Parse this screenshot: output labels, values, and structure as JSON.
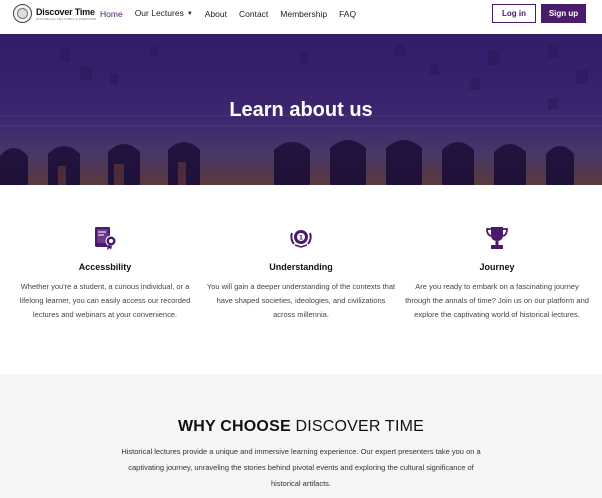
{
  "header": {
    "logo_title": "Discover Time",
    "logo_sub": "HISTORICAL LECTURES & WEBINARS",
    "nav": [
      {
        "label": "Home",
        "active": true
      },
      {
        "label": "Our Lectures",
        "dropdown": true
      },
      {
        "label": "About"
      },
      {
        "label": "Contact"
      },
      {
        "label": "Membership"
      },
      {
        "label": "FAQ"
      }
    ],
    "login_label": "Log in",
    "signup_label": "Sign up"
  },
  "hero": {
    "title": "Learn about us"
  },
  "features": [
    {
      "icon": "book-badge-icon",
      "title": "Accessbility",
      "text": "Whether you're a student, a curious individual, or a lifelong learner, you can easily access our recorded lectures and webinars at your convenience."
    },
    {
      "icon": "laurel-badge-icon",
      "title": "Understanding",
      "text": "You will gain a deeper understanding of the contexts that have shaped societies, ideologies, and civilizations across millennia."
    },
    {
      "icon": "trophy-icon",
      "title": "Journey",
      "text": "Are you ready to embark on a fascinating journey through the annals of time? Join us on our platform and explore the captivating world of historical lectures."
    }
  ],
  "why": {
    "title_bold": "WHY CHOOSE",
    "title_light": "DISCOVER TIME",
    "text": "Historical lectures provide a unique and immersive learning experience. Our expert presenters take you on a captivating journey, unraveling the stories behind pivotal events and exploring the cultural significance of historical artifacts."
  },
  "colors": {
    "brand": "#4a1a6b",
    "hero_overlay": "#3a1f73",
    "section_bg": "#f5f5f7"
  }
}
